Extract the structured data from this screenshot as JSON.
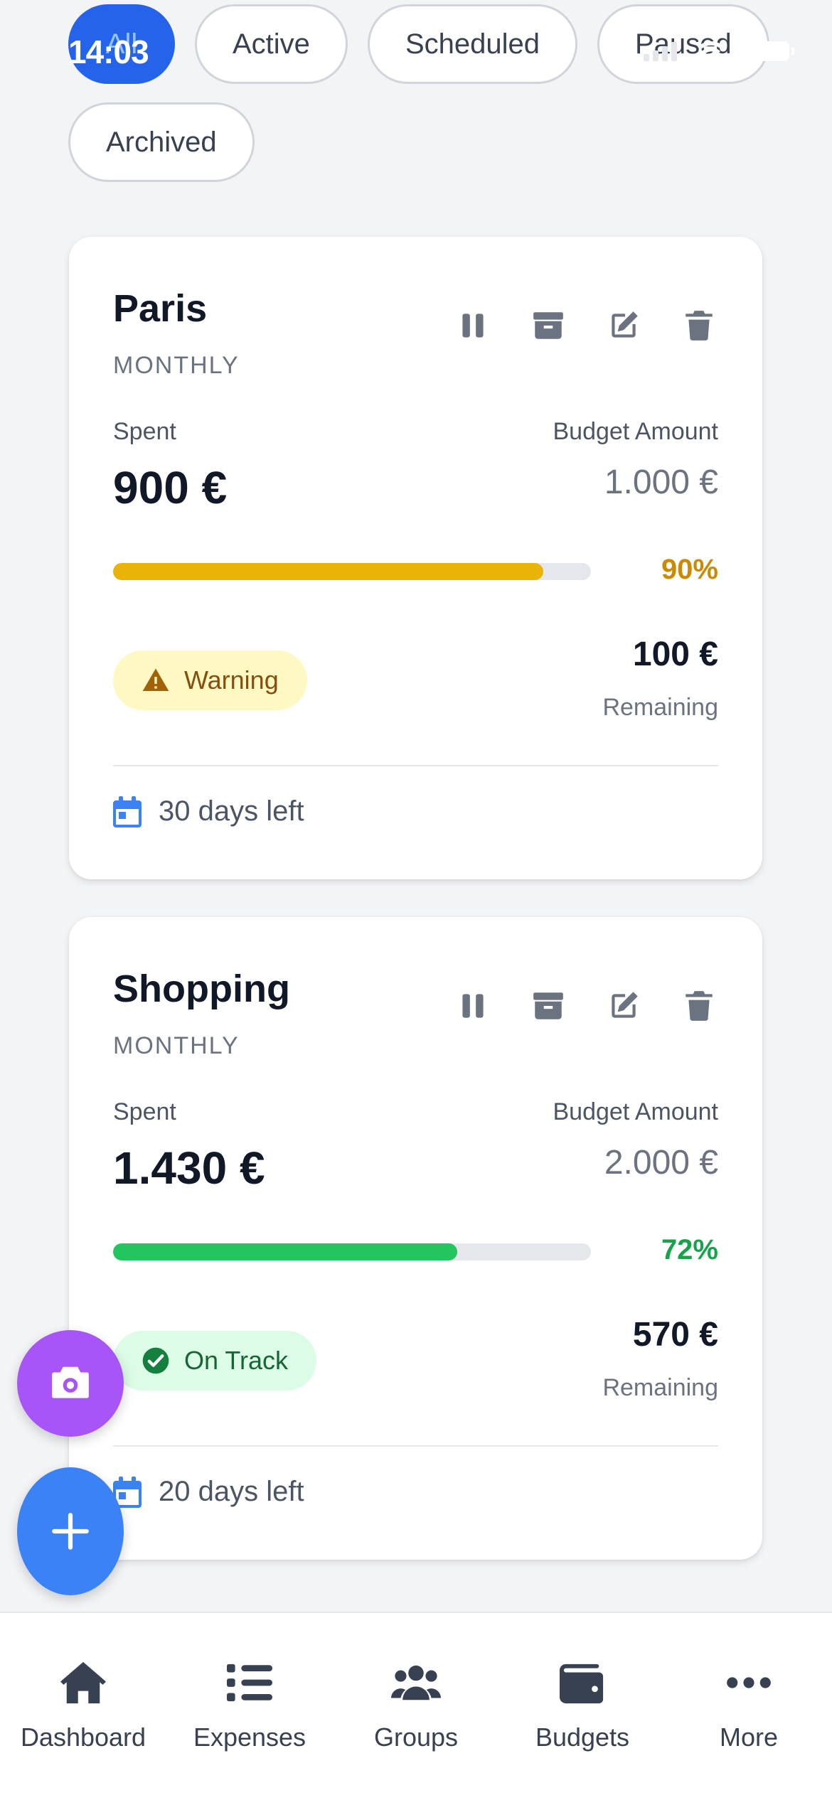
{
  "status_bar": {
    "time": "14:03"
  },
  "filters": {
    "chips": [
      {
        "label": "All",
        "active": true
      },
      {
        "label": "Active",
        "active": false
      },
      {
        "label": "Scheduled",
        "active": false
      },
      {
        "label": "Paused",
        "active": false
      },
      {
        "label": "Archived",
        "active": false
      }
    ]
  },
  "budgets": [
    {
      "name": "Paris",
      "period": "MONTHLY",
      "spent_label": "Spent",
      "spent": "900 €",
      "budget_label": "Budget Amount",
      "budget": "1.000 €",
      "progress_percent": 90,
      "progress_text": "90%",
      "progress_color": "#EAB308",
      "percent_color": "#CA8A04",
      "status": "Warning",
      "status_bg": "#FEF9C3",
      "status_fg": "#854D0E",
      "status_icon": "warning-triangle-icon",
      "remaining": "100 €",
      "remaining_label": "Remaining",
      "days_left": "30 days left"
    },
    {
      "name": "Shopping",
      "period": "MONTHLY",
      "spent_label": "Spent",
      "spent": "1.430 €",
      "budget_label": "Budget Amount",
      "budget": "2.000 €",
      "progress_percent": 72,
      "progress_text": "72%",
      "progress_color": "#22C55E",
      "percent_color": "#16A34A",
      "status": "On Track",
      "status_bg": "#DCFCE7",
      "status_fg": "#166534",
      "status_icon": "check-circle-icon",
      "remaining": "570 €",
      "remaining_label": "Remaining",
      "days_left": "20 days left"
    }
  ],
  "fabs": {
    "camera_icon": "camera-icon",
    "add_icon": "plus-icon",
    "camera_color": "#A855F7",
    "add_color": "#3B82F6"
  },
  "nav": {
    "items": [
      {
        "label": "Dashboard",
        "icon": "home-icon"
      },
      {
        "label": "Expenses",
        "icon": "list-icon"
      },
      {
        "label": "Groups",
        "icon": "users-icon"
      },
      {
        "label": "Budgets",
        "icon": "wallet-icon"
      },
      {
        "label": "More",
        "icon": "more-dots-icon"
      }
    ]
  }
}
